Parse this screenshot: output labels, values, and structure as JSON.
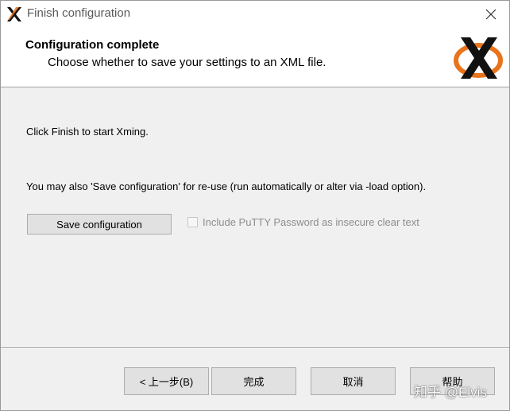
{
  "window": {
    "title": "Finish configuration"
  },
  "header": {
    "title": "Configuration complete",
    "subtitle": "Choose whether to save your settings to an XML file."
  },
  "body": {
    "line1": "Click Finish to start Xming.",
    "line2": "You may also 'Save configuration' for re-use (run automatically or alter via -load option).",
    "save_button": "Save configuration",
    "checkbox_label": "Include PuTTY Password as insecure clear text",
    "checkbox_checked": false
  },
  "footer": {
    "back_button": "< 上一步(B)",
    "finish_button": "完成",
    "cancel_button": "取消",
    "help_button": "帮助"
  },
  "watermark": "知乎 @Elvis",
  "icons": {
    "app": "xming-x-icon",
    "close": "close-icon",
    "logo": "xming-logo-icon"
  },
  "colors": {
    "logo_orange": "#e8741c",
    "window_bg": "#f0f0f0",
    "header_bg": "#ffffff"
  }
}
